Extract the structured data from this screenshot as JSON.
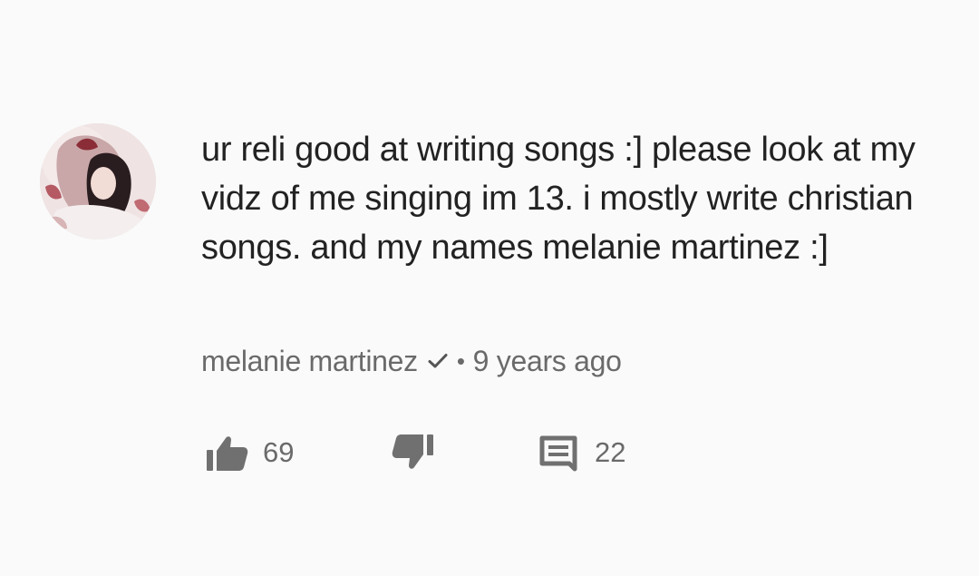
{
  "comment": {
    "text": "ur reli good at writing songs :] please look at my vidz of me singing im 13. i mostly write christian songs. and my names melanie martinez  :]",
    "author": "melanie martinez",
    "separator": "•",
    "timestamp": "9 years ago",
    "avatar_icon": "user-avatar-photo",
    "verified_icon": "checkmark-icon"
  },
  "actions": {
    "like_icon": "thumbs-up-icon",
    "like_count": "69",
    "dislike_icon": "thumbs-down-icon",
    "reply_icon": "comment-icon",
    "reply_count": "22"
  },
  "colors": {
    "background": "#fafafa",
    "text": "#222222",
    "meta": "#6a6a6a",
    "icon": "#707070"
  }
}
